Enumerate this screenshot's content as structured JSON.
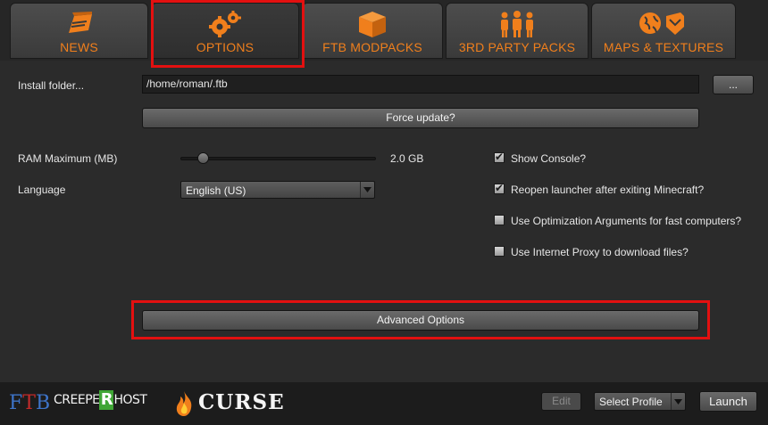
{
  "tabs": [
    {
      "label": "NEWS",
      "icon": "news-icon"
    },
    {
      "label": "OPTIONS",
      "icon": "gears-icon"
    },
    {
      "label": "FTB MODPACKS",
      "icon": "box-icon"
    },
    {
      "label": "3RD PARTY PACKS",
      "icon": "people-icon"
    },
    {
      "label": "MAPS & TEXTURES",
      "icon": "globe-icon"
    }
  ],
  "options": {
    "install_folder_label": "Install folder...",
    "install_folder_value": "/home/roman/.ftb",
    "browse_label": "...",
    "force_update_label": "Force update?",
    "ram_label": "RAM Maximum (MB)",
    "ram_value": "2.0 GB",
    "ram_slider_fraction": 0.09,
    "language_label": "Language",
    "language_value": "English (US)",
    "checkboxes": [
      {
        "label": "Show Console?",
        "checked": true
      },
      {
        "label": "Reopen launcher after exiting Minecraft?",
        "checked": true
      },
      {
        "label": "Use Optimization Arguments for fast computers?",
        "checked": false
      },
      {
        "label": "Use Internet Proxy to download files?",
        "checked": false
      }
    ],
    "advanced_label": "Advanced Options"
  },
  "footer": {
    "logos": {
      "ftb": "FTB",
      "creeper": "CREEPERHOST",
      "curse": "CURSE"
    },
    "edit_label": "Edit",
    "profile_select": "Select Profile",
    "launch_label": "Launch"
  },
  "colors": {
    "accent": "#f07f1c",
    "highlight": "#e31010",
    "background": "#2b2b2b"
  }
}
